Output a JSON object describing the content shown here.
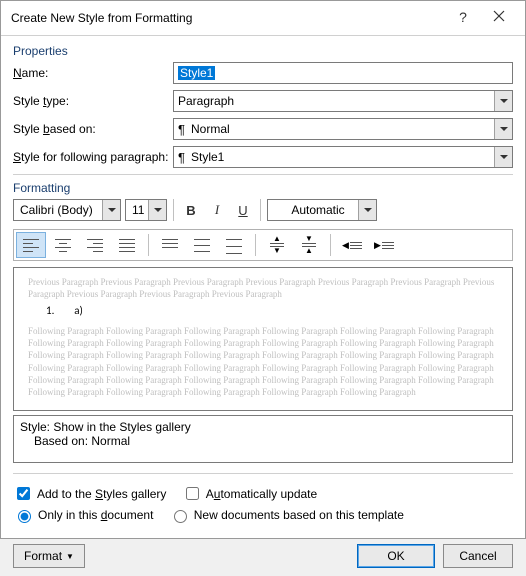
{
  "titlebar": {
    "title": "Create New Style from Formatting"
  },
  "sections": {
    "properties": "Properties",
    "formatting": "Formatting"
  },
  "labels": {
    "name": "ame:",
    "style_type": "Style ",
    "style_type2": "type:",
    "based_on": "Style ",
    "based_on2": "based on:",
    "following": "Style for following paragraph:"
  },
  "values": {
    "name": "Style1",
    "style_type": "Paragraph",
    "based_on": "Normal",
    "following": "Style1"
  },
  "formatting": {
    "font": "Calibri (Body)",
    "size": "11",
    "color": "Automatic"
  },
  "preview": {
    "prev": "Previous Paragraph Previous Paragraph Previous Paragraph Previous Paragraph Previous Paragraph Previous Paragraph Previous Paragraph Previous Paragraph Previous Paragraph Previous Paragraph",
    "sample_num": "1.",
    "sample_sub": "a)",
    "foll": "Following Paragraph Following Paragraph Following Paragraph Following Paragraph Following Paragraph Following Paragraph Following Paragraph Following Paragraph Following Paragraph Following Paragraph Following Paragraph Following Paragraph Following Paragraph Following Paragraph Following Paragraph Following Paragraph Following Paragraph Following Paragraph Following Paragraph Following Paragraph Following Paragraph Following Paragraph Following Paragraph Following Paragraph Following Paragraph Following Paragraph Following Paragraph Following Paragraph Following Paragraph Following Paragraph Following Paragraph Following Paragraph Following Paragraph Following Paragraph Following Paragraph"
  },
  "desc": {
    "line1": "Style: Show in the Styles gallery",
    "line2": "Based on: Normal"
  },
  "checks": {
    "add_gallery_pre": "Add to the ",
    "add_gallery_u": "S",
    "add_gallery_post": "tyles gallery",
    "auto_update_pre": "A",
    "auto_update_u": "u",
    "auto_update_post": "tomatically update",
    "only_doc_pre": "Only in this ",
    "only_doc_u": "d",
    "only_doc_post": "ocument",
    "new_docs": "New documents based on this template"
  },
  "footer": {
    "format_pre": "F",
    "format_u": "o",
    "format_post": "rmat",
    "ok": "OK",
    "cancel": "Cancel"
  }
}
